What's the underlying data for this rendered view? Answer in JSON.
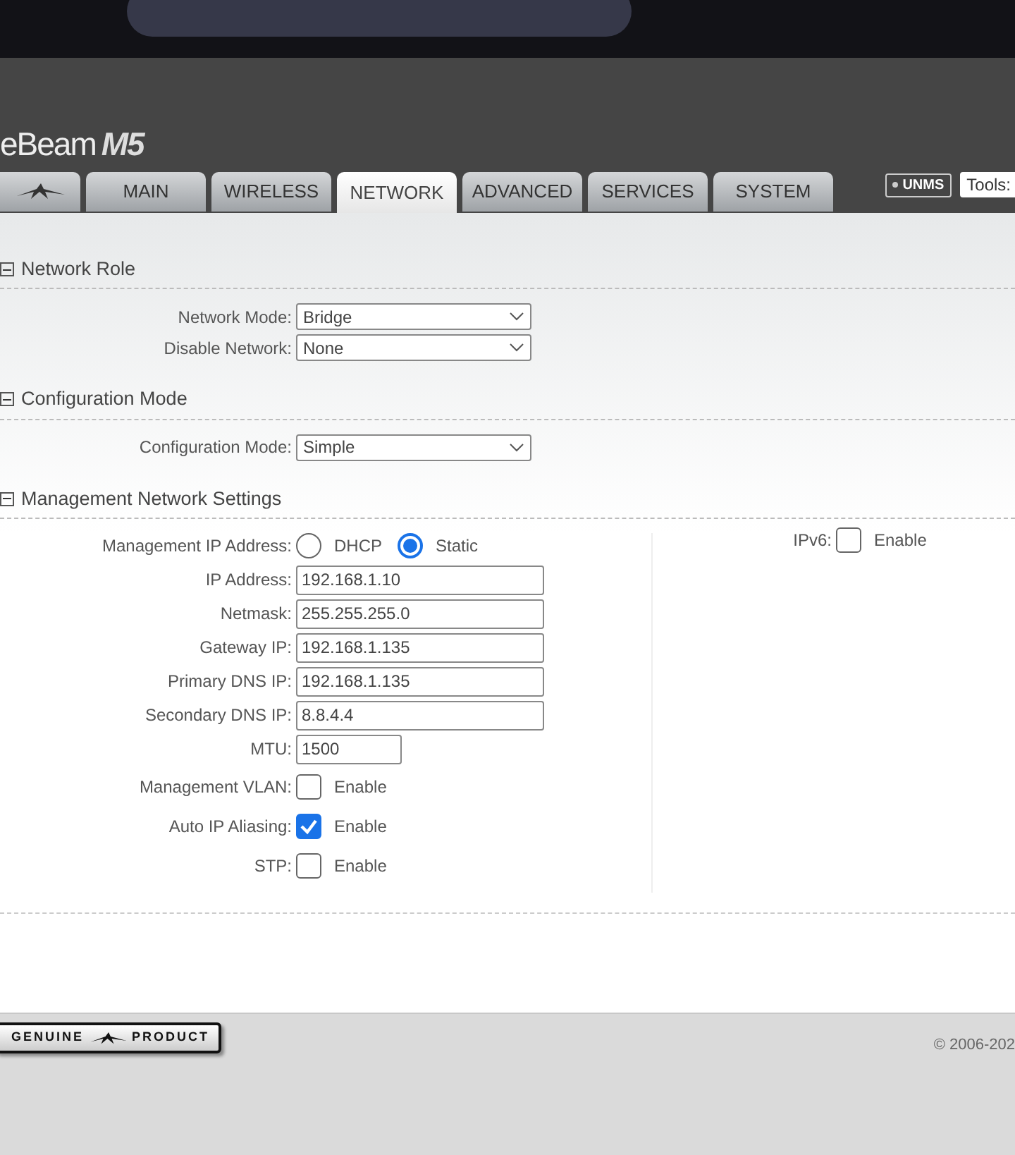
{
  "header": {
    "product_name": "eBeam",
    "model": "M5"
  },
  "tabs": [
    {
      "kind": "logo",
      "selected": false
    },
    {
      "kind": "text",
      "label": "MAIN",
      "selected": false
    },
    {
      "kind": "text",
      "label": "WIRELESS",
      "selected": false
    },
    {
      "kind": "text",
      "label": "NETWORK",
      "selected": true
    },
    {
      "kind": "text",
      "label": "ADVANCED",
      "selected": false
    },
    {
      "kind": "text",
      "label": "SERVICES",
      "selected": false
    },
    {
      "kind": "text",
      "label": "SYSTEM",
      "selected": false
    }
  ],
  "toolbar": {
    "unms_badge": "UNMS",
    "tools_label": "Tools:"
  },
  "sections": [
    {
      "title": "Network Role",
      "expanded": true,
      "fields": [
        {
          "kind": "select",
          "label": "Network Mode:",
          "value": "Bridge"
        },
        {
          "kind": "select",
          "label": "Disable Network:",
          "value": "None"
        }
      ]
    },
    {
      "title": "Configuration Mode",
      "expanded": true,
      "fields": [
        {
          "kind": "select",
          "label": "Configuration Mode:",
          "value": "Simple"
        }
      ]
    },
    {
      "title": "Management Network Settings",
      "expanded": true,
      "fields": [
        {
          "kind": "radio",
          "label": "Management IP Address:",
          "options": [
            {
              "label": "DHCP",
              "selected": false
            },
            {
              "label": "Static",
              "selected": true
            }
          ]
        },
        {
          "kind": "text",
          "label": "IP Address:",
          "value": "192.168.1.10"
        },
        {
          "kind": "text",
          "label": "Netmask:",
          "value": "255.255.255.0"
        },
        {
          "kind": "text",
          "label": "Gateway IP:",
          "value": "192.168.1.135"
        },
        {
          "kind": "text",
          "label": "Primary DNS IP:",
          "value": "192.168.1.135"
        },
        {
          "kind": "text",
          "label": "Secondary DNS IP:",
          "value": "8.8.4.4"
        },
        {
          "kind": "short_text",
          "label": "MTU:",
          "value": "1500"
        },
        {
          "kind": "checkbox",
          "label": "Management VLAN:",
          "option": "Enable",
          "checked": false
        },
        {
          "kind": "checkbox",
          "label": "Auto IP Aliasing:",
          "option": "Enable",
          "checked": true
        },
        {
          "kind": "checkbox",
          "label": "STP:",
          "option": "Enable",
          "checked": false
        }
      ],
      "side_fields": [
        {
          "kind": "checkbox",
          "label": "IPv6:",
          "option": "Enable",
          "checked": false
        }
      ]
    }
  ],
  "footer": {
    "badge_left": "GENUINE",
    "badge_right": "PRODUCT",
    "copyright": "© 2006-202"
  }
}
